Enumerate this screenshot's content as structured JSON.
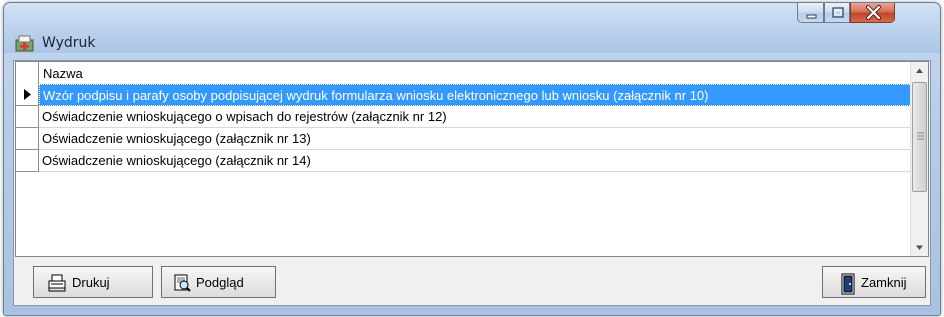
{
  "window": {
    "title": "Wydruk",
    "icon": "printer-form-icon"
  },
  "title_controls": {
    "minimize_icon": "minimize-icon",
    "maximize_icon": "maximize-icon",
    "close_icon": "close-icon"
  },
  "grid": {
    "column_header": "Nazwa",
    "selected_index": 0,
    "rows": [
      {
        "label": "Wzór podpisu i parafy osoby podpisującej wydruk formularza wniosku elektronicznego lub wniosku (załącznik nr 10)"
      },
      {
        "label": "Oświadczenie wnioskującego o wpisach do rejestrów (załącznik nr 12)"
      },
      {
        "label": "Oświadczenie wnioskującego (załącznik nr 13)"
      },
      {
        "label": "Oświadczenie wnioskującego (załącznik nr 14)"
      }
    ]
  },
  "buttons": {
    "print_label": "Drukuj",
    "preview_label": "Podgląd",
    "close_label": "Zamknij"
  },
  "colors": {
    "selection": "#3399ff",
    "selection_text": "#ffffff"
  }
}
